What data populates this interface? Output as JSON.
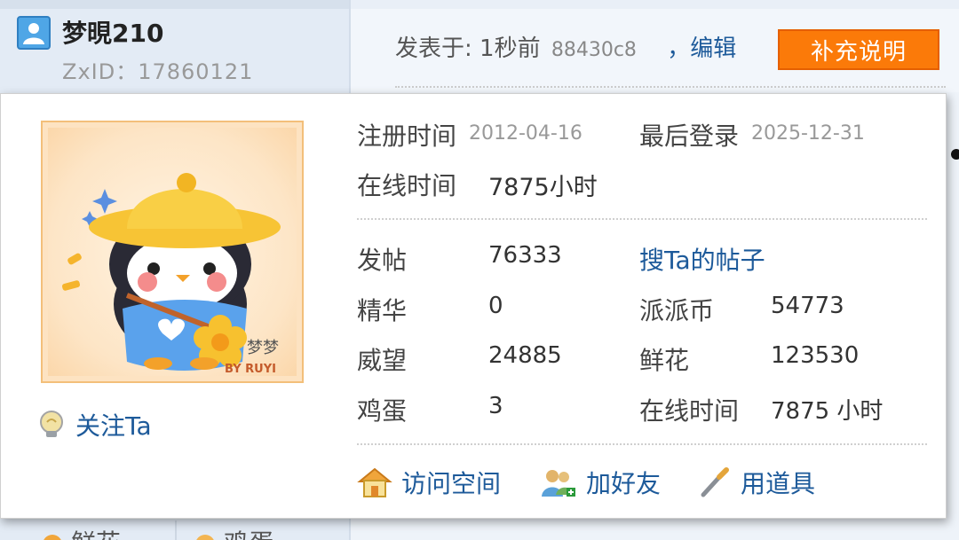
{
  "header": {
    "username": "梦晛210",
    "zxid_label": "ZxID：",
    "zxid_value": "17860121",
    "posted_prefix": "发表于: 1秒前",
    "post_hash": "88430c8",
    "edit_link": "，编辑",
    "supplement_button": "补充说明"
  },
  "profile": {
    "follow_label": "关注Ta",
    "register_label": "注册时间",
    "register_date": "2012-04-16",
    "last_login_label": "最后登录",
    "last_login_date": "2025-12-31",
    "online_label": "在线时间",
    "online_value": "7875小时"
  },
  "stats": {
    "posts_label": "发帖",
    "posts_value": "76333",
    "search_posts_link": "搜Ta的帖子",
    "essence_label": "精华",
    "essence_value": "0",
    "coins_label": "派派币",
    "coins_value": "54773",
    "prestige_label": "威望",
    "prestige_value": "24885",
    "flowers_label": "鲜花",
    "flowers_value": "123530",
    "eggs_label": "鸡蛋",
    "eggs_value": "3",
    "online2_label": "在线时间",
    "online2_value": "7875 小时"
  },
  "actions": {
    "visit_space": "访问空间",
    "add_friend": "加好友",
    "use_item": "用道具"
  },
  "bottom_tabs": {
    "flowers": "鲜花",
    "eggs": "鸡蛋"
  },
  "avatar": {
    "signature": "梦梦",
    "tag": "BY RUYI"
  },
  "colors": {
    "accent_orange": "#fb7a09",
    "link_blue": "#1d5a9a"
  }
}
